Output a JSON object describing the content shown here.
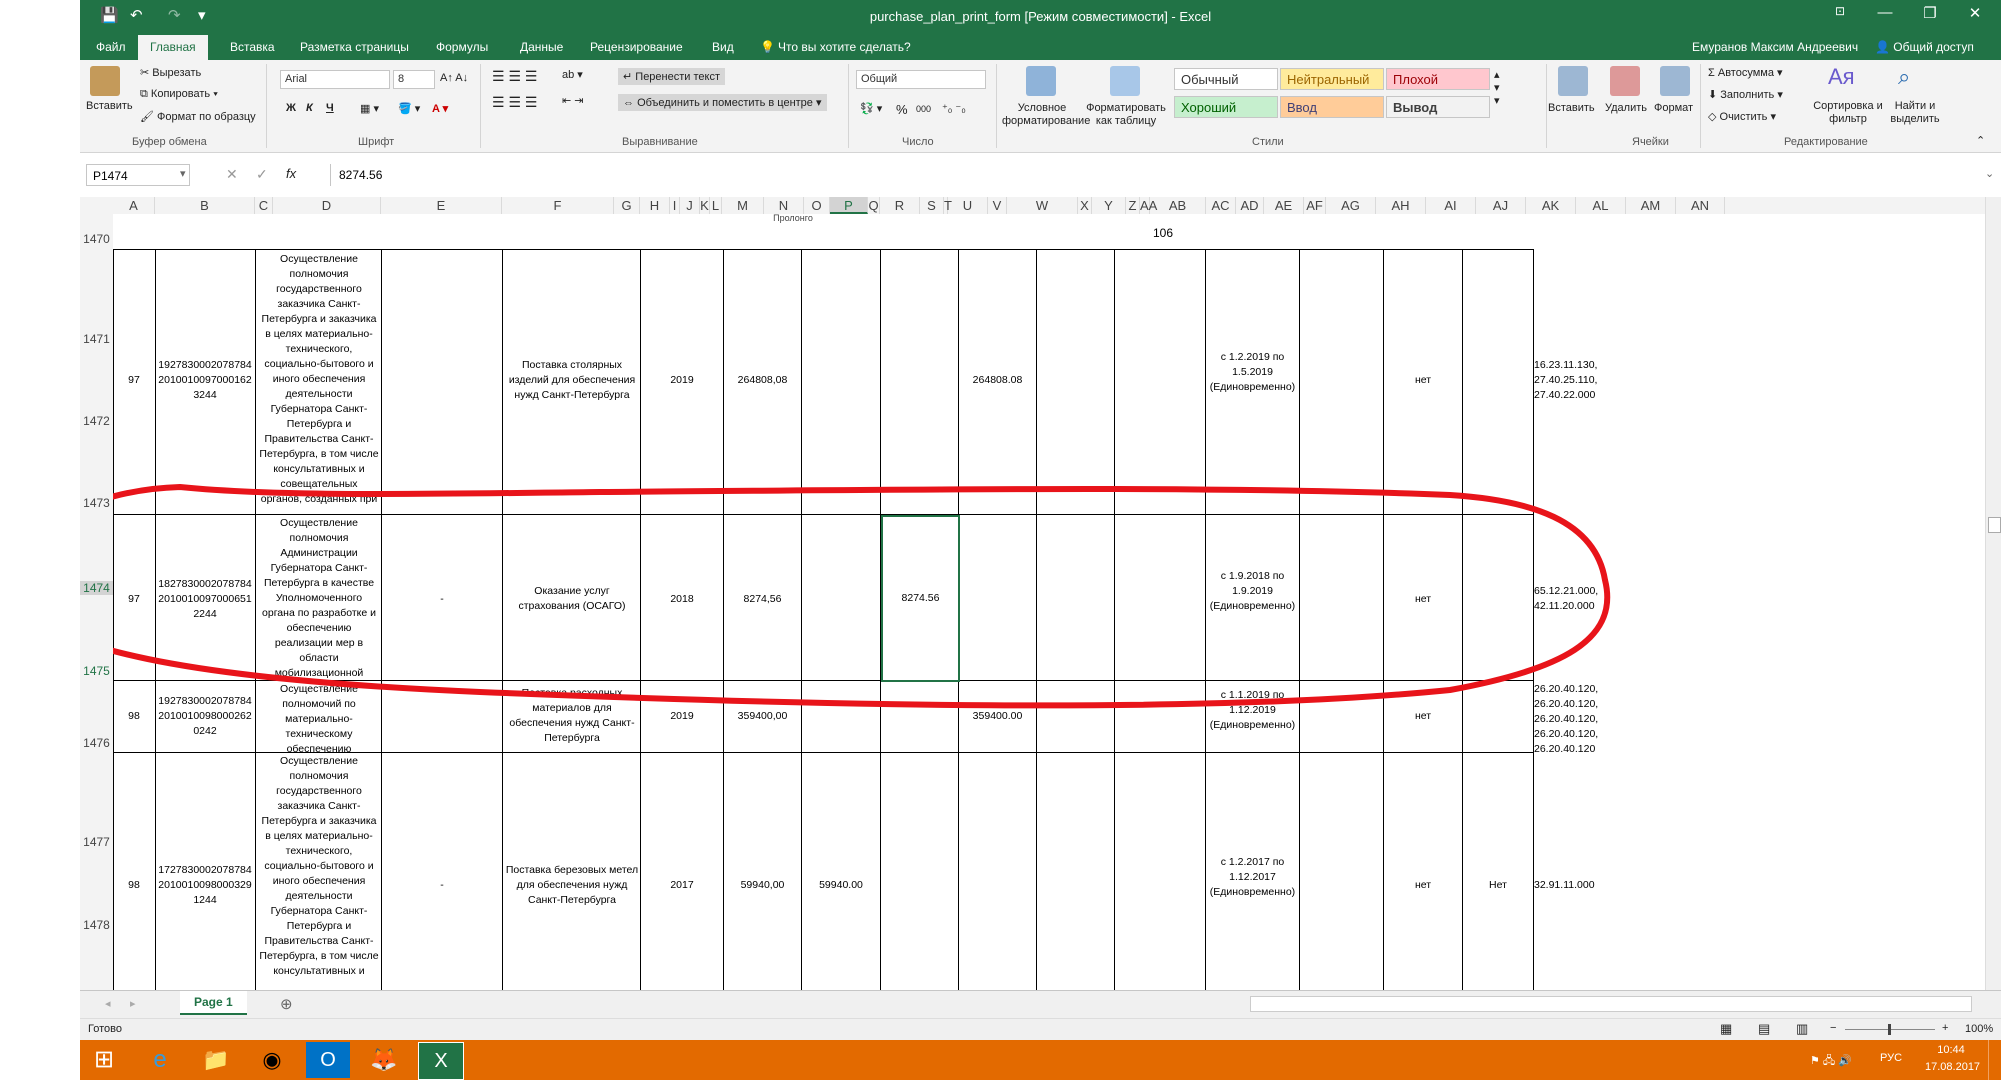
{
  "window": {
    "title": "purchase_plan_print_form  [Режим совместимости] - Excel",
    "controls": {
      "help": "?",
      "restore_ribbon": "⊡",
      "minimize": "—",
      "maximize": "❐",
      "close": "✕"
    }
  },
  "quick_access": {
    "save": "💾",
    "undo": "↶",
    "redo": "↷",
    "customize": "▾"
  },
  "tabs": [
    "Файл",
    "Главная",
    "Вставка",
    "Разметка страницы",
    "Формулы",
    "Данные",
    "Рецензирование",
    "Вид"
  ],
  "tell_me": "Что вы хотите сделать?",
  "user": "Емуранов Максим Андреевич",
  "share": "Общий доступ",
  "ribbon": {
    "clipboard": {
      "paste": "Вставить",
      "cut": "Вырезать",
      "copy": "Копировать",
      "format_painter": "Формат по образцу",
      "group": "Буфер обмена"
    },
    "font": {
      "name": "Arial",
      "size": "8",
      "bold": "Ж",
      "italic": "К",
      "underline": "Ч",
      "group": "Шрифт"
    },
    "alignment": {
      "wrap": "Перенести текст",
      "merge": "Объединить и поместить в центре",
      "group": "Выравнивание"
    },
    "number": {
      "format": "Общий",
      "percent": "%",
      "thousands": "000",
      "group": "Число"
    },
    "styles": {
      "conditional": "Условное форматирование",
      "as_table": "Форматировать как таблицу",
      "normal": "Обычный",
      "neutral": "Нейтральный",
      "bad": "Плохой",
      "good": "Хороший",
      "input": "Ввод",
      "output": "Вывод",
      "group": "Стили"
    },
    "cells": {
      "insert": "Вставить",
      "delete": "Удалить",
      "format": "Формат",
      "group": "Ячейки"
    },
    "editing": {
      "autosum": "Автосумма",
      "fill": "Заполнить",
      "clear": "Очистить",
      "sort": "Сортировка и фильтр",
      "find": "Найти и выделить",
      "group": "Редактирование"
    }
  },
  "formula_bar": {
    "name_box": "P1474",
    "cancel": "✕",
    "enter": "✓",
    "fx": "fx",
    "value": "8274.56"
  },
  "columns": [
    "A",
    "B",
    "C",
    "D",
    "E",
    "F",
    "G",
    "H",
    "I",
    "J",
    "K",
    "L",
    "M",
    "N",
    "O",
    "P",
    "Q",
    "R",
    "S",
    "T",
    "U",
    "V",
    "W",
    "X",
    "Y",
    "Z",
    "AA",
    "AB",
    "AC",
    "AD",
    "AE",
    "AF",
    "AG",
    "AH",
    "AI",
    "AJ",
    "AK",
    "AL",
    "AM",
    "AN"
  ],
  "row_numbers": [
    "1470",
    "1471",
    "1472",
    "1473",
    "1474",
    "1475",
    "1476",
    "1477",
    "1478"
  ],
  "header_row": {
    "fragment": "Пролонго",
    "page_number": "106"
  },
  "rows": [
    {
      "num": "97",
      "code": "192783000207878420100100970001623244",
      "purpose": "Осуществление полномочия государственного заказчика Санкт-Петербурга и заказчика в целях материально-технического, социально-бытового и иного обеспечения деятельности Губернатора Санкт-Петербурга и Правительства Санкт-Петербурга, в том числе консультативных и совещательных органов, созданных при",
      "e": "",
      "subject": "Поставка столярных изделий для обеспечения нужд Санкт-Петербурга",
      "year": "2019",
      "total": "264808,08",
      "n": "",
      "p": "",
      "r": "264808.08",
      "period": "с 1.2.2019  по 1.5.2019 (Единовременно)",
      "ab": "нет",
      "ad": "",
      "okpd": "16.23.11.130, 27.40.25.110, 27.40.22.000"
    },
    {
      "num": "97",
      "code": "182783000207878420100100970006512244",
      "purpose": "Осуществление полномочия Администрации Губернатора Санкт-Петербурга в качестве Уполномоченного органа по разработке и обеспечению реализации мер в области мобилизационной подготовки и",
      "e": "-",
      "subject": "Оказание услуг страхования (ОСАГО)",
      "year": "2018",
      "total": "8274,56",
      "n": "",
      "p": "8274.56",
      "r": "",
      "period": "с 1.9.2018  по 1.9.2019 (Единовременно)",
      "ab": "нет",
      "ad": "",
      "okpd": "65.12.21.000, 42.11.20.000"
    },
    {
      "num": "98",
      "code": "192783000207878420100100980002620242",
      "purpose": "Осуществление полномочий по материально-техническому обеспечению",
      "e": "",
      "subject": "Поставка расходных материалов для обеспечения нужд Санкт-Петербурга",
      "year": "2019",
      "total": "359400,00",
      "n": "",
      "p": "",
      "r": "359400.00",
      "period": "с 1.1.2019  по 1.12.2019 (Единовременно)",
      "ab": "нет",
      "ad": "",
      "okpd": "26.20.40.120, 26.20.40.120, 26.20.40.120, 26.20.40.120, 26.20.40.120"
    },
    {
      "num": "98",
      "code": "172783000207878420100100980003291244",
      "purpose": "Осуществление полномочия государственного заказчика Санкт-Петербурга и заказчика в целях материально-технического, социально-бытового и иного обеспечения деятельности Губернатора Санкт-Петербурга и Правительства Санкт-Петербурга, в том числе консультативных и",
      "e": "-",
      "subject": "Поставка березовых метел для обеспечения нужд Санкт-Петербурга",
      "year": "2017",
      "total": "59940,00",
      "n": "59940.00",
      "p": "",
      "r": "",
      "period": "с 1.2.2017  по 1.12.2017 (Единовременно)",
      "ab": "нет",
      "ad": "Нет",
      "okpd": "32.91.11.000"
    }
  ],
  "sheet": {
    "name": "Page 1",
    "add": "⊕"
  },
  "status": {
    "ready": "Готово",
    "zoom": "100%",
    "minus": "−",
    "plus": "+"
  },
  "taskbar": {
    "lang": "РУС",
    "time": "10:44",
    "date": "17.08.2017"
  },
  "annotation_color": "#e8141a",
  "accent_color": "#217346"
}
